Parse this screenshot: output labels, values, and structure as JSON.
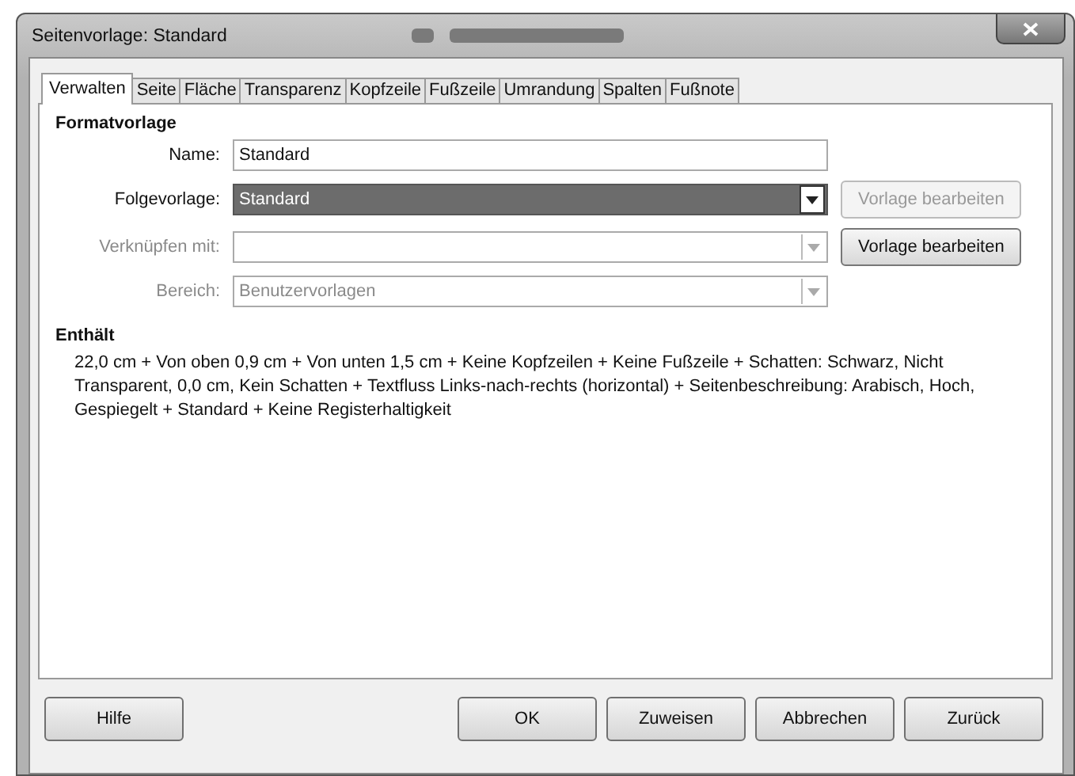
{
  "window": {
    "title": "Seitenvorlage: Standard"
  },
  "tabs": [
    {
      "label": "Verwalten",
      "selected": true
    },
    {
      "label": "Seite",
      "selected": false
    },
    {
      "label": "Fläche",
      "selected": false
    },
    {
      "label": "Transparenz",
      "selected": false
    },
    {
      "label": "Kopfzeile",
      "selected": false
    },
    {
      "label": "Fußzeile",
      "selected": false
    },
    {
      "label": "Umrandung",
      "selected": false
    },
    {
      "label": "Spalten",
      "selected": false
    },
    {
      "label": "Fußnote",
      "selected": false
    }
  ],
  "formatvorlage": {
    "heading": "Formatvorlage",
    "fields": [
      {
        "label": "Name:",
        "kind": "text",
        "value": "Standard",
        "disabled": false,
        "focused": false
      },
      {
        "label": "Folgevorlage:",
        "kind": "combo",
        "value": "Standard",
        "disabled": false,
        "focused": true,
        "button": {
          "label": "Vorlage bearbeiten",
          "disabled": true
        }
      },
      {
        "label": "Verknüpfen mit:",
        "kind": "combo",
        "disabled": true,
        "focused": false,
        "button": {
          "label": "Vorlage bearbeiten",
          "disabled": false
        }
      },
      {
        "label": "Bereich:",
        "kind": "combo",
        "value": "Benutzervorlagen",
        "disabled": true,
        "focused": false
      }
    ]
  },
  "enthaelt": {
    "heading": "Enthält",
    "text": "22,0 cm + Von oben 0,9 cm + Von unten 1,5 cm + Keine Kopfzeilen + Keine Fußzeile + Schatten: Schwarz, Nicht Transparent, 0,0 cm, Kein Schatten + Textfluss Links-nach-rechts (horizontal) + Seitenbeschreibung: Arabisch, Hoch, Gespiegelt + Standard + Keine Registerhaltigkeit"
  },
  "left_buttons": [
    "Hilfe"
  ],
  "right_buttons": [
    "OK",
    "Zuweisen",
    "Abbrechen",
    "Zurück"
  ]
}
